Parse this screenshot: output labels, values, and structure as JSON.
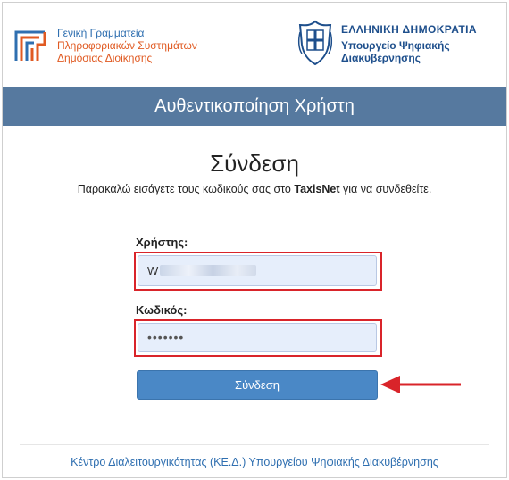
{
  "header": {
    "left_logo": {
      "icon": "gsis-logo-icon",
      "lines": [
        "Γενική Γραμματεία",
        "Πληροφοριακών Συστημάτων",
        "Δημόσιας Διοίκησης"
      ]
    },
    "right_logo": {
      "icon": "greek-emblem-icon",
      "title": "ΕΛΛΗΝΙΚΗ ΔΗΜΟΚΡΑΤΙΑ",
      "lines": [
        "Υπουργείο Ψηφιακής",
        "Διακυβέρνησης"
      ]
    }
  },
  "banner": {
    "title": "Αυθεντικοποίηση Χρήστη",
    "color": "#56799f"
  },
  "login": {
    "title": "Σύνδεση",
    "subtitle_before": "Παρακαλώ εισάγετε τους κωδικούς σας στο ",
    "subtitle_bold": "TaxisNet",
    "subtitle_after": " για να συνδεθείτε.",
    "username": {
      "label": "Χρήστης:",
      "value": "W"
    },
    "password": {
      "label": "Κωδικός:",
      "value": "•••••••"
    },
    "submit_label": "Σύνδεση",
    "highlight_color": "#d9242a"
  },
  "footer": {
    "text": "Κέντρο Διαλειτουργικότητας (ΚΕ.Δ.) Υπουργείου Ψηφιακής Διακυβέρνησης"
  }
}
